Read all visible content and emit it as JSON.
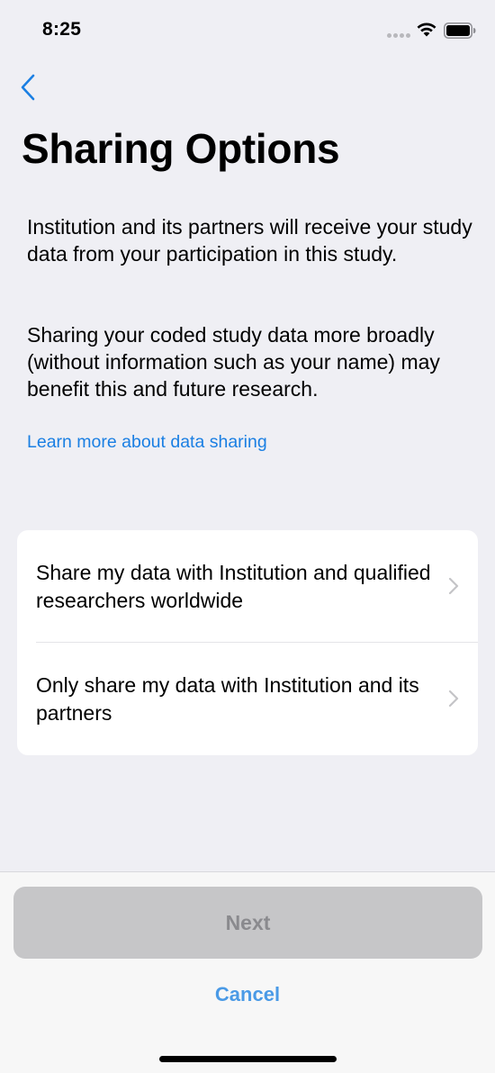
{
  "status_bar": {
    "time": "8:25",
    "icons": [
      "signal-icon",
      "wifi-icon",
      "battery-icon"
    ]
  },
  "nav": {
    "back_icon": "chevron-left-icon"
  },
  "page": {
    "title": "Sharing Options",
    "paragraphs": [
      "Institution and its partners will receive your study data from your participation in this study.",
      "Sharing your coded study data more broadly (without information such as your name) may benefit this and future research."
    ],
    "learn_more_link": "Learn more about data sharing"
  },
  "options": [
    {
      "label": "Share my data with Institution and qualified researchers worldwide",
      "icon": "chevron-right-icon"
    },
    {
      "label": "Only share my data with Institution and its partners",
      "icon": "chevron-right-icon"
    }
  ],
  "footer": {
    "next_label": "Next",
    "next_enabled": false,
    "cancel_label": "Cancel"
  },
  "colors": {
    "background": "#efeff4",
    "accent": "#1a7fe3",
    "card": "#ffffff",
    "disabled_button": "#c6c6c8",
    "disabled_text": "#8a8a8e"
  }
}
